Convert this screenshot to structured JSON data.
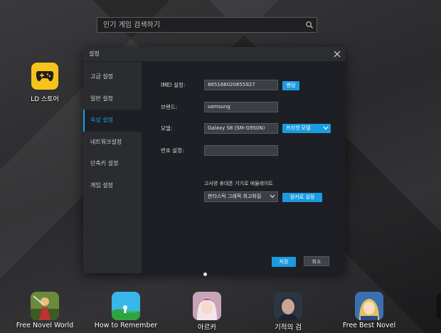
{
  "search": {
    "placeholder": "인기 게임 검색하기"
  },
  "desktop": {
    "ld_store_label": "LD 스토어"
  },
  "dialog": {
    "title": "설정",
    "sidebar": [
      {
        "label": "고급 설정",
        "active": false
      },
      {
        "label": "일반 설정",
        "active": false
      },
      {
        "label": "속성 설정",
        "active": true
      },
      {
        "label": "네트워크설정",
        "active": false
      },
      {
        "label": "단축키 설정",
        "active": false
      },
      {
        "label": "게임 설정",
        "active": false
      }
    ],
    "imei": {
      "label": "IMEI 설정:",
      "value": "865166020655927",
      "button": "랜덤"
    },
    "brand": {
      "label": "브랜드:",
      "value": "samsung"
    },
    "model": {
      "label": "모델:",
      "value": "Galaxy S8 (SM-G950N)",
      "preset": "프리셋 모델"
    },
    "phone": {
      "label": "번호 설정:",
      "value": ""
    },
    "emulate_caption": "고사양 휴대폰 기기로 에뮬레이트",
    "emulate_select": "판타스틱 그래픽 최고화질",
    "one_click_button": "원키로 설정",
    "save_button": "저장",
    "cancel_button": "취소"
  },
  "dock": [
    {
      "label": "Free Novel World",
      "icon": "free-novel-world-icon"
    },
    {
      "label": "How to Remember",
      "icon": "how-to-remember-icon"
    },
    {
      "label": "아르카",
      "icon": "arka-icon"
    },
    {
      "label": "기적의 검",
      "icon": "sword-of-miracle-icon"
    },
    {
      "label": "Free Best Novel",
      "icon": "free-best-novel-icon"
    }
  ],
  "colors": {
    "accent": "#1aa3e8",
    "ld_yellow": "#f7c31b"
  }
}
